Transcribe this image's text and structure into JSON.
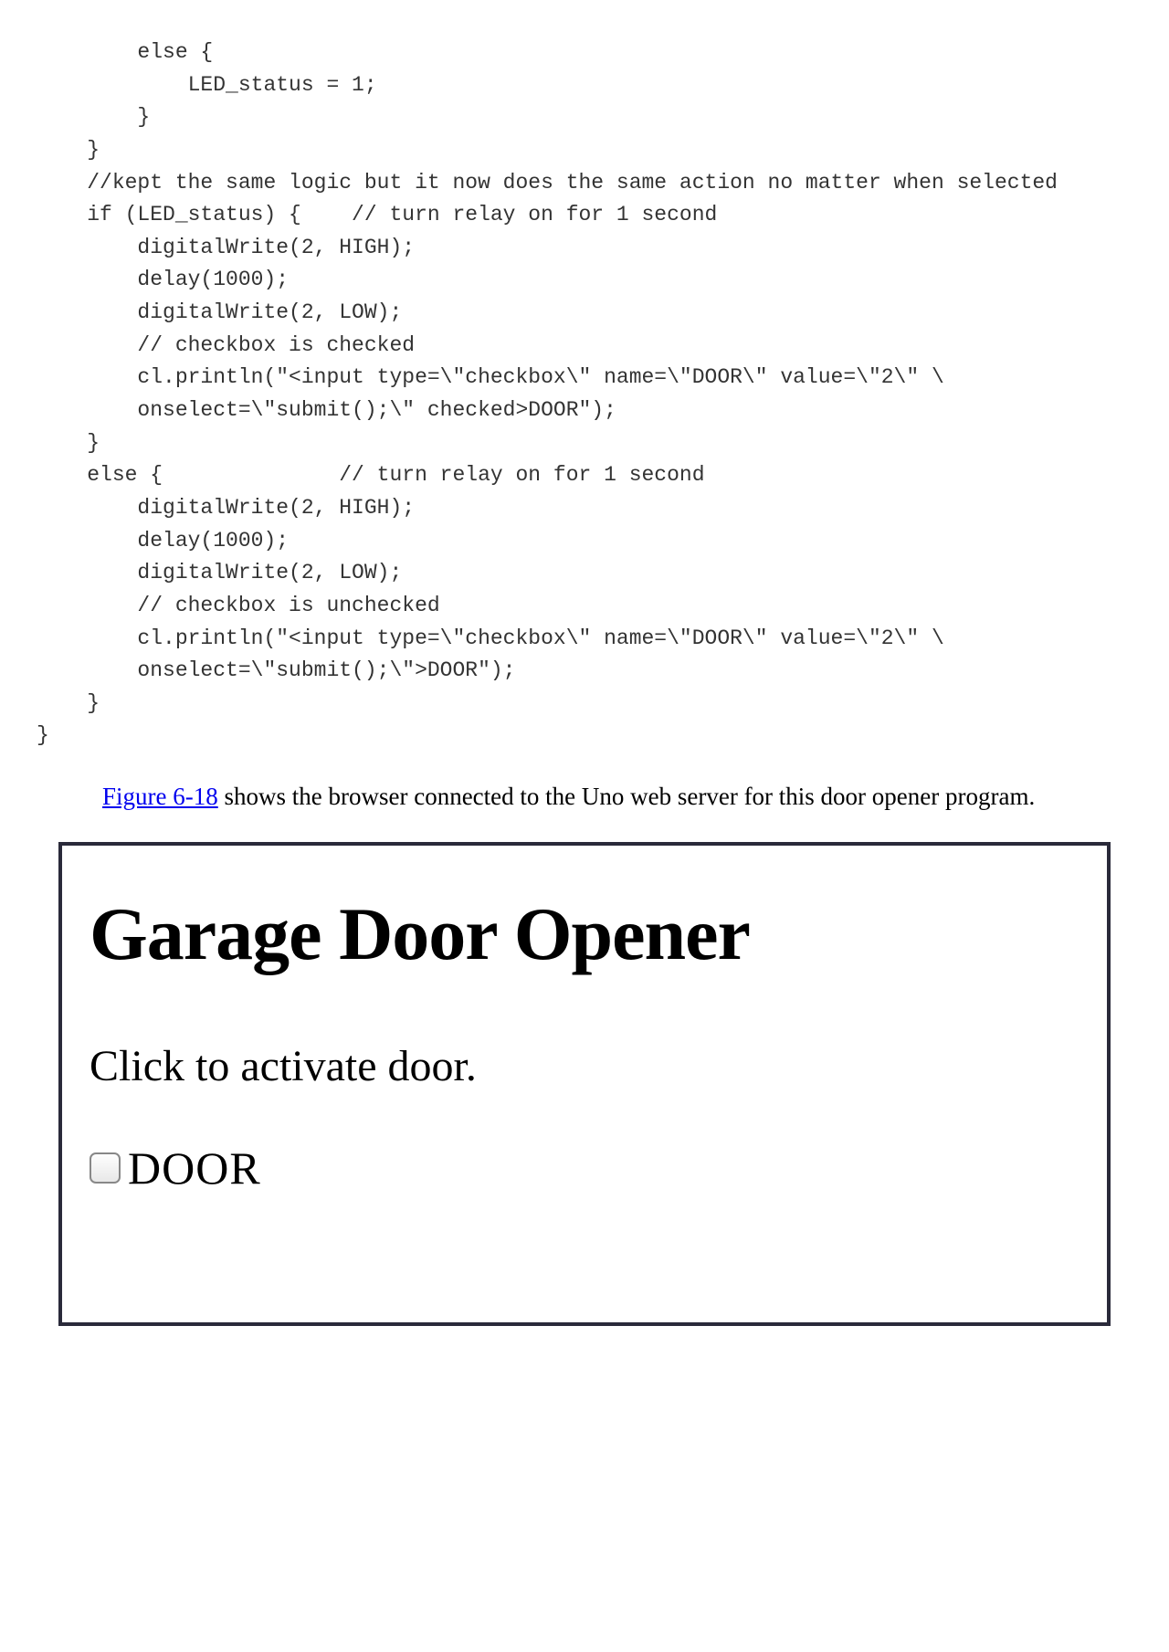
{
  "code": "        else {\n            LED_status = 1;\n        }\n    }\n    //kept the same logic but it now does the same action no matter when selected\n    if (LED_status) {    // turn relay on for 1 second\n        digitalWrite(2, HIGH);\n        delay(1000);\n        digitalWrite(2, LOW);\n        // checkbox is checked\n        cl.println(\"<input type=\\\"checkbox\\\" name=\\\"DOOR\\\" value=\\\"2\\\" \\\n        onselect=\\\"submit();\\\" checked>DOOR\");\n    }\n    else {              // turn relay on for 1 second\n        digitalWrite(2, HIGH);\n        delay(1000);\n        digitalWrite(2, LOW);\n        // checkbox is unchecked\n        cl.println(\"<input type=\\\"checkbox\\\" name=\\\"DOOR\\\" value=\\\"2\\\" \\\n        onselect=\\\"submit();\\\">DOOR\");\n    }\n}",
  "caption": {
    "link_text": "Figure 6-18",
    "rest": " shows the browser connected to the Uno web server for this door opener program."
  },
  "figure": {
    "title": "Garage Door Opener",
    "subtitle": "Click to activate door.",
    "checkbox_label": "DOOR"
  }
}
